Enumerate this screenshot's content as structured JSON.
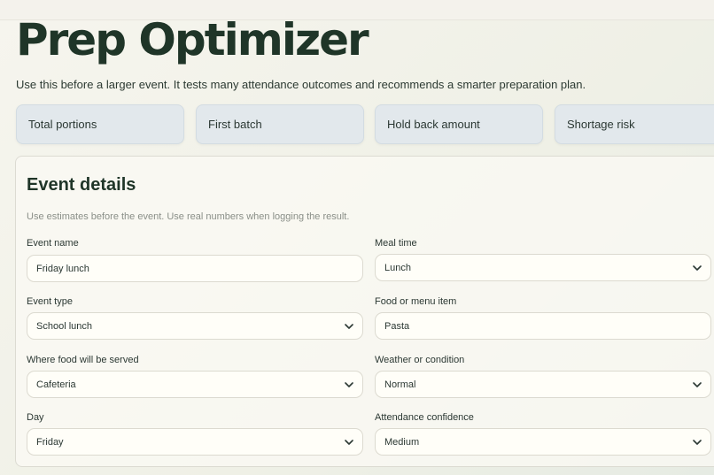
{
  "header": {
    "title": "Prep Optimizer",
    "subtitle": "Use this before a larger event. It tests many attendance outcomes and recommends a smarter preparation plan."
  },
  "stats": [
    {
      "label": "Total portions"
    },
    {
      "label": "First batch"
    },
    {
      "label": "Hold back amount"
    },
    {
      "label": "Shortage risk"
    }
  ],
  "event": {
    "title": "Event details",
    "hint": "Use estimates before the event. Use real numbers when logging the result.",
    "fields": [
      {
        "label": "Event name",
        "value": "Friday lunch",
        "kind": "text"
      },
      {
        "label": "Meal time",
        "value": "Lunch",
        "kind": "select"
      },
      {
        "label": "Event type",
        "value": "School lunch",
        "kind": "select"
      },
      {
        "label": "Food or menu item",
        "value": "Pasta",
        "kind": "text"
      },
      {
        "label": "Where food will be served",
        "value": "Cafeteria",
        "kind": "select"
      },
      {
        "label": "Weather or condition",
        "value": "Normal",
        "kind": "select"
      },
      {
        "label": "Day",
        "value": "Friday",
        "kind": "select"
      },
      {
        "label": "Attendance confidence",
        "value": "Medium",
        "kind": "select"
      }
    ]
  },
  "icons": {
    "dropdown": "chevron-down-icon"
  },
  "colors": {
    "title": "#1f3528",
    "stat_bg": "#e2e8ec"
  }
}
